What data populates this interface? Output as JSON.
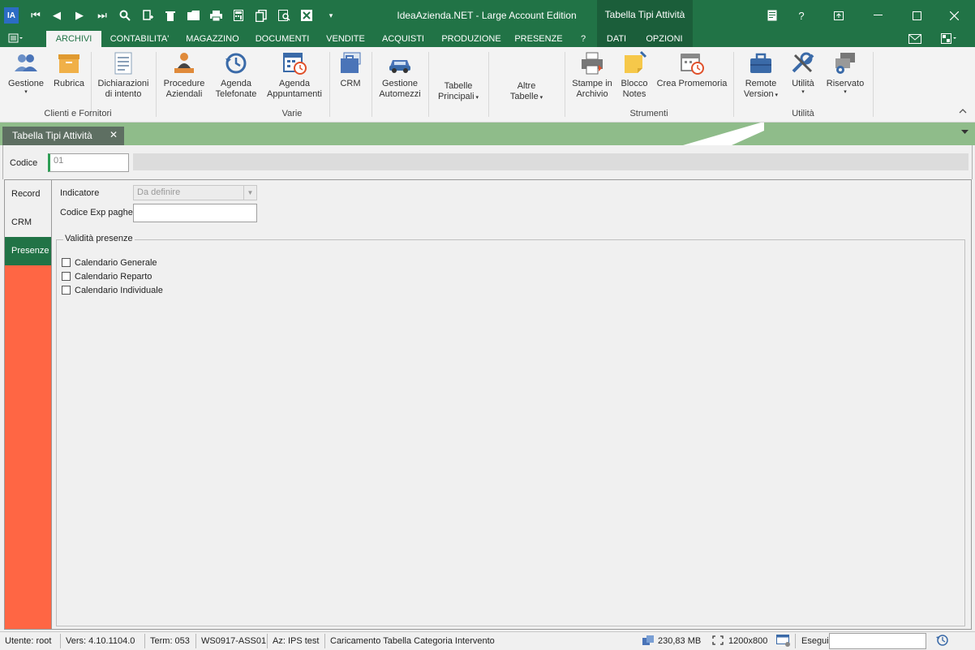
{
  "window": {
    "title": "IdeaAzienda.NET - Large Account Edition",
    "context_title": "Tabella Tipi Attività",
    "logo_text": "IA"
  },
  "quick_access": [
    "first-icon",
    "prev-icon",
    "next-icon",
    "last-icon",
    "search-icon",
    "new-doc-icon",
    "delete-icon",
    "folder-icon",
    "print-icon",
    "calculator-icon",
    "copy-icon",
    "preview-icon",
    "excel-icon",
    "customize-icon"
  ],
  "ribbon_tabs": [
    {
      "label": "ARCHIVI",
      "active": true
    },
    {
      "label": "CONTABILITA'"
    },
    {
      "label": "MAGAZZINO"
    },
    {
      "label": "DOCUMENTI"
    },
    {
      "label": "VENDITE"
    },
    {
      "label": "ACQUISTI"
    },
    {
      "label": "PRODUZIONE"
    },
    {
      "label": "PRESENZE"
    },
    {
      "label": "?"
    },
    {
      "label": "DATI"
    },
    {
      "label": "OPZIONI"
    }
  ],
  "ribbon": {
    "groups": {
      "clienti": "Clienti e Fornitori",
      "varie": "Varie",
      "strumenti": "Strumenti",
      "utilita": "Utilità"
    },
    "buttons": {
      "gestione": "Gestione",
      "rubrica": "Rubrica",
      "dichiarazioni_1": "Dichiarazioni",
      "dichiarazioni_2": "di intento",
      "procedure_1": "Procedure",
      "procedure_2": "Aziendali",
      "agenda_tel_1": "Agenda",
      "agenda_tel_2": "Telefonate",
      "agenda_app_1": "Agenda",
      "agenda_app_2": "Appuntamenti",
      "crm": "CRM",
      "automezzi_1": "Gestione",
      "automezzi_2": "Automezzi",
      "tabelle_1": "Tabelle",
      "tabelle_2": "Principali",
      "altre_1": "Altre",
      "altre_2": "Tabelle",
      "stampe_1": "Stampe in",
      "stampe_2": "Archivio",
      "blocco_1": "Blocco",
      "blocco_2": "Notes",
      "promemoria": "Crea Promemoria",
      "remote_1": "Remote",
      "remote_2": "Version",
      "utilita": "Utilità",
      "riservato": "Riservato"
    }
  },
  "doc_tab": {
    "label": "Tabella Tipi Attività"
  },
  "code_row": {
    "label": "Codice",
    "value": "01"
  },
  "side_tabs": [
    {
      "label": "Record"
    },
    {
      "label": "CRM"
    },
    {
      "label": "Presenze",
      "active": true
    }
  ],
  "form": {
    "indicatore_label": "Indicatore",
    "indicatore_value": "Da definire",
    "paghe_label": "Codice Exp paghe",
    "validita_title": "Validità presenze",
    "checkboxes": [
      {
        "label": "Calendario Generale",
        "checked": false
      },
      {
        "label": "Calendario Reparto",
        "checked": false
      },
      {
        "label": "Calendario Individuale",
        "checked": false
      }
    ]
  },
  "status": {
    "utente": "Utente: root",
    "versione": "Vers: 4.10.1104.0",
    "term": "Term: 053",
    "workstation": "WS0917-ASS01",
    "azienda": "Az: IPS test",
    "message": "Caricamento Tabella Categoria Intervento",
    "memory": "230,83 MB",
    "resolution": "1200x800",
    "esegui": "Esegui"
  },
  "colors": {
    "accent": "#217346",
    "side_bg": "#ff6644",
    "strip": "#8fbc8a"
  }
}
